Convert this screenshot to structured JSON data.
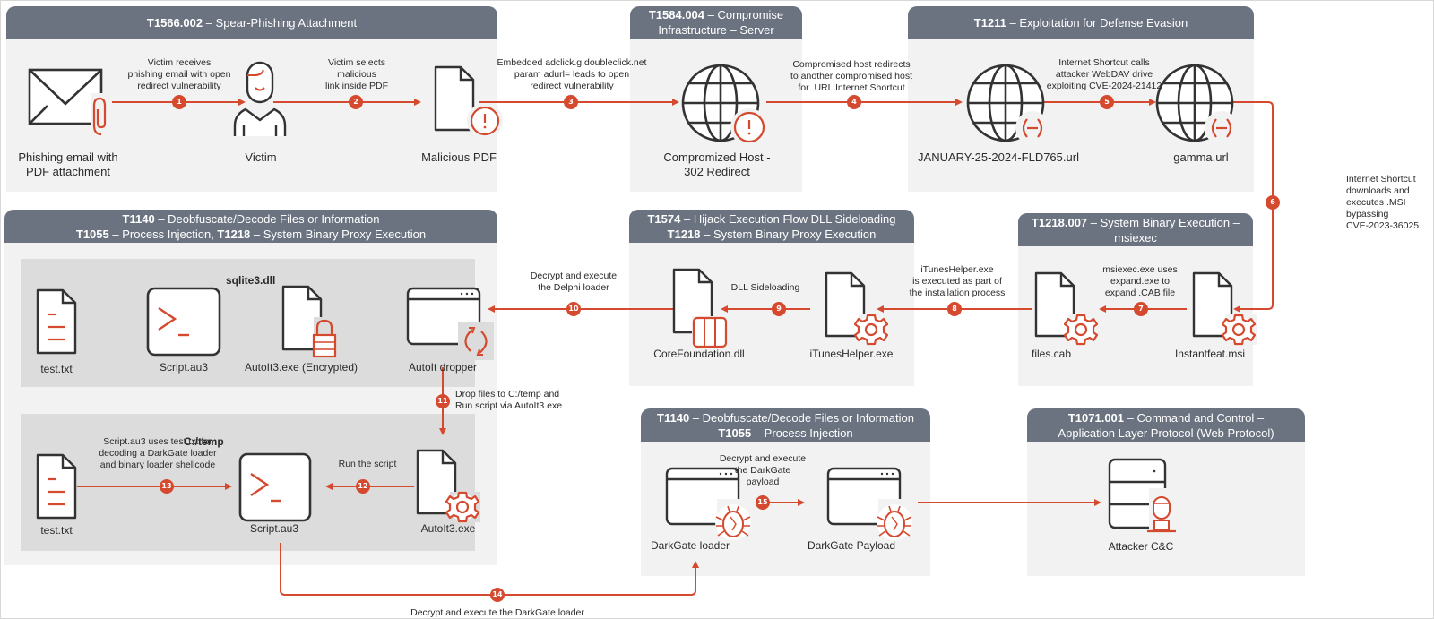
{
  "colors": {
    "accent": "#d5492e",
    "header": "#6b7380",
    "panel": "#f2f2f2",
    "subpanel": "#dcdcdc",
    "icon_stroke": "#333333"
  },
  "panels": {
    "p1": {
      "lines": [
        {
          "code": "T1566.002",
          "text": " – Spear-Phishing Attachment"
        }
      ]
    },
    "p2": {
      "lines": [
        {
          "code": "T1584.004",
          "text": " – Compromise"
        },
        {
          "code": "",
          "text": "Infrastructure – Server"
        }
      ]
    },
    "p3": {
      "lines": [
        {
          "code": "T1211",
          "text": " – Exploitation for Defense Evasion"
        }
      ]
    },
    "p4": {
      "lines": [
        {
          "code": "T1140",
          "text": " – Deobfuscate/Decode Files or Information"
        },
        {
          "code": "T1055",
          "text": " – Process Injection, ",
          "code2": "T1218",
          "text2": " – System Binary Proxy Execution"
        }
      ]
    },
    "p5": {
      "lines": [
        {
          "code": "T1574",
          "text": " – Hijack Execution Flow DLL Sideloading"
        },
        {
          "code": "T1218",
          "text": " – System Binary Proxy Execution"
        }
      ]
    },
    "p6": {
      "lines": [
        {
          "code": "T1218.007",
          "text": " – System Binary Execution –  msiexec"
        }
      ]
    },
    "p7": {
      "lines": [
        {
          "code": "T1140",
          "text": " – Deobfuscate/Decode Files or Information"
        },
        {
          "code": "T1055",
          "text": " – Process Injection"
        }
      ]
    },
    "p8": {
      "lines": [
        {
          "code": "T1071.001",
          "text": " – Command and Control –"
        },
        {
          "code": "",
          "text": "Application Layer Protocol (Web Protocol)"
        }
      ]
    }
  },
  "subpanels": {
    "sqlite": "sqlite3.dll",
    "temp": "C:/temp"
  },
  "nodes": {
    "email": {
      "label_1": "Phishing email with",
      "label_2": "PDF attachment",
      "icon": "envelope-paperclip-icon"
    },
    "victim": {
      "label_1": "Victim",
      "icon": "person-icon"
    },
    "pdf": {
      "label_1": "Malicious PDF",
      "icon": "document-warning-icon"
    },
    "host": {
      "label_1": "Compromized Host -",
      "label_2": "302 Redirect",
      "icon": "globe-warning-icon"
    },
    "jan": {
      "label_1": "JANUARY-25-2024-FLD765.url",
      "icon": "globe-link-icon"
    },
    "gamma": {
      "label_1": "gamma.url",
      "icon": "globe-link-icon"
    },
    "msi": {
      "label_1": "Instantfeat.msi",
      "icon": "document-gear-icon"
    },
    "cab": {
      "label_1": "files.cab",
      "icon": "document-gear-icon"
    },
    "itunes": {
      "label_1": "iTunesHelper.exe",
      "icon": "document-gear-icon"
    },
    "corefnd": {
      "label_1": "CoreFoundation.dll",
      "icon": "document-library-icon"
    },
    "test1": {
      "label_1": "test.txt",
      "icon": "text-document-icon"
    },
    "script1": {
      "label_1": "Script.au3",
      "icon": "terminal-icon"
    },
    "autoit_enc": {
      "label_1": "AutoIt3.exe (Encrypted)",
      "icon": "document-lock-icon"
    },
    "dropper": {
      "label_1": "AutoIt dropper",
      "icon": "window-refresh-icon"
    },
    "test2": {
      "label_1": "test.txt",
      "icon": "text-document-icon"
    },
    "script2": {
      "label_1": "Script.au3",
      "icon": "terminal-icon"
    },
    "autoit": {
      "label_1": "AutoIt3.exe",
      "icon": "document-gear-icon"
    },
    "dgloader": {
      "label_1": "DarkGate loader",
      "icon": "window-bug-icon"
    },
    "dgpayload": {
      "label_1": "DarkGate Payload",
      "icon": "window-bug-icon"
    },
    "cnc": {
      "label_1": "Attacker C&C",
      "icon": "server-attacker-icon"
    }
  },
  "edges": [
    {
      "num": "1",
      "lines": [
        "Victim receives",
        "phishing email with open",
        "redirect vulnerability"
      ]
    },
    {
      "num": "2",
      "lines": [
        "Victim selects",
        "malicious",
        "link inside PDF"
      ]
    },
    {
      "num": "3",
      "lines": [
        "Embedded adclick.g.doubleclick.net",
        "param adurl= leads to open",
        "redirect vulnerability"
      ]
    },
    {
      "num": "4",
      "lines": [
        "Compromised host redirects",
        "to another compromised host",
        "for .URL Internet Shortcut"
      ]
    },
    {
      "num": "5",
      "lines": [
        "Internet Shortcut calls",
        "attacker WebDAV drive",
        "exploiting CVE-2024-21412"
      ]
    },
    {
      "num": "6",
      "lines": [
        "Internet Shortcut",
        "downloads and",
        "executes .MSI",
        "bypassing",
        "CVE-2023-36025"
      ]
    },
    {
      "num": "7",
      "lines": [
        "msiexec.exe uses",
        "expand.exe to",
        "expand .CAB file"
      ]
    },
    {
      "num": "8",
      "lines": [
        "iTunesHelper.exe",
        "is executed as part of",
        "the installation process"
      ]
    },
    {
      "num": "9",
      "lines": [
        "DLL Sideloading"
      ]
    },
    {
      "num": "10",
      "lines": [
        "Decrypt and execute",
        "the Delphi loader"
      ]
    },
    {
      "num": "11",
      "lines": [
        "Drop files to C:/temp and",
        "Run script via AutoIt3.exe"
      ]
    },
    {
      "num": "12",
      "lines": [
        "Run the script"
      ]
    },
    {
      "num": "13",
      "lines": [
        "Script.au3 uses test.txt for",
        "decoding a DarkGate loader",
        "and binary loader shellcode"
      ]
    },
    {
      "num": "14",
      "lines": [
        "Decrypt and execute the DarkGate loader"
      ]
    },
    {
      "num": "15",
      "lines": [
        "Decrypt and execute",
        "the DarkGate",
        "payload"
      ]
    }
  ]
}
